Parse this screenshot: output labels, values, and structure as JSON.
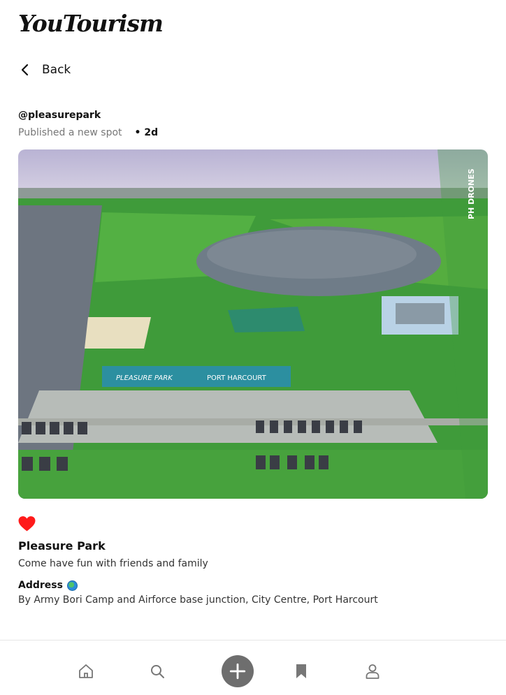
{
  "app": {
    "name": "YouTourism"
  },
  "nav": {
    "back_label": "Back"
  },
  "post": {
    "username": "@pleasurepark",
    "action": "Published a new spot",
    "age": "• 2d",
    "photo_watermark": "PH DRONES",
    "photo_signs": [
      "PLEASURE PARK",
      "PORT HARCOURT"
    ],
    "liked": true
  },
  "spot": {
    "title": "Pleasure Park",
    "description": "Come have fun with friends and family",
    "address_label": "Address",
    "address": "By Army Bori Camp and Airforce base junction, City Centre, Port Harcourt"
  },
  "tabs": [
    {
      "name": "home",
      "icon": "home-icon"
    },
    {
      "name": "search",
      "icon": "search-icon"
    },
    {
      "name": "add",
      "icon": "plus-icon"
    },
    {
      "name": "saved",
      "icon": "bookmark-icon"
    },
    {
      "name": "profile",
      "icon": "user-icon"
    }
  ],
  "colors": {
    "heart": "#ff1a1a",
    "add_button": "#6e6e6e",
    "icon": "#777777"
  }
}
